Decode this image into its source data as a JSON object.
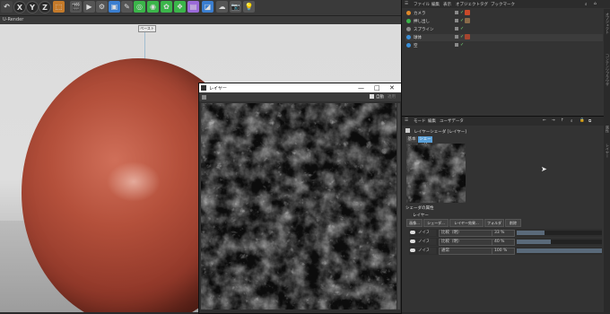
{
  "toolbar": {
    "axis_x": "X",
    "axis_y": "Y",
    "axis_z": "Z"
  },
  "viewport": {
    "title": "U-Render",
    "axis_tag": "ペースト"
  },
  "layer_window": {
    "title": "レイヤー",
    "auto_label": "自動",
    "apply_label": "適用"
  },
  "object_manager": {
    "menu": [
      "ファイル",
      "編集",
      "表示",
      "オブジェクト",
      "タグ",
      "ブックマーク"
    ],
    "objects": [
      {
        "name": "カメラ",
        "color": "#e08a2a"
      },
      {
        "name": "押し出し",
        "color": "#3bb54a"
      },
      {
        "name": "スプライン",
        "color": "#8a8a8a"
      },
      {
        "name": "球体",
        "color": "#3a8fd8"
      },
      {
        "name": "空",
        "color": "#3a8fd8"
      }
    ]
  },
  "attribute_manager": {
    "menu": [
      "モード",
      "編集",
      "ユーザデータ"
    ],
    "title": "レイヤーシェーダ [レイヤー]",
    "tabs": [
      "基本",
      "シェーダ"
    ],
    "section_title": "シェーダの属性",
    "section_sub": "レイヤー",
    "buttons": [
      "画像...",
      "シェーダ...",
      "レイヤー効果...",
      "フォルダ",
      "削除"
    ],
    "layers": [
      {
        "name": "ノイズ",
        "mode": "比較（明）",
        "percent": "33 %",
        "value": 0.33
      },
      {
        "name": "ノイズ",
        "mode": "比較（明）",
        "percent": "40 %",
        "value": 0.4
      },
      {
        "name": "ノイズ",
        "mode": "通常",
        "percent": "100 %",
        "value": 1.0
      }
    ]
  },
  "side_tabs": [
    "オブジェクト",
    "コンテンツブラウザ",
    "属性",
    "レイヤー"
  ],
  "colors": {
    "accent": "#5aa0d8",
    "sphere": "#a5452f",
    "active_tool": "#3bb54a"
  }
}
